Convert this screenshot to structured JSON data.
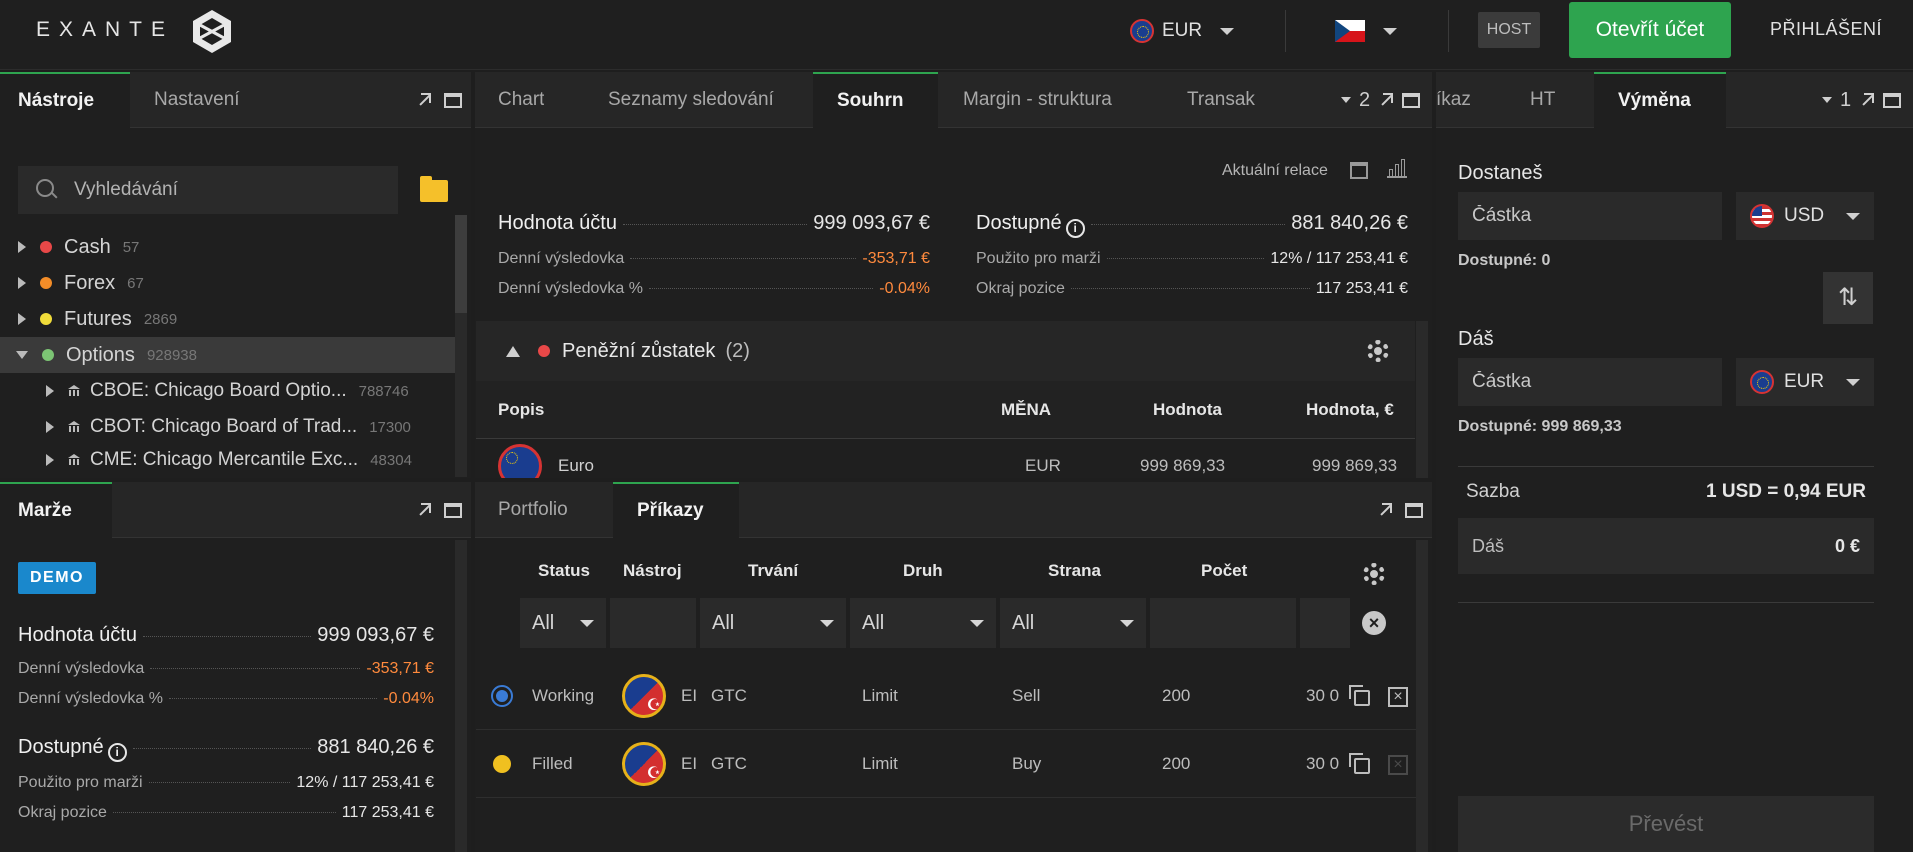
{
  "header": {
    "logo_text": "EXANTE",
    "currency": "EUR",
    "language_flag": "cz-flag",
    "host_label": "HOST",
    "open_account_label": "Otevřít účet",
    "login_label": "PŘIHLÁŠENÍ"
  },
  "left_top": {
    "tabs": [
      "Nástroje",
      "Nastavení"
    ],
    "search_placeholder": "Vyhledávání",
    "tree": [
      {
        "label": "Cash",
        "count": "57",
        "color": "#e84848"
      },
      {
        "label": "Forex",
        "count": "67",
        "color": "#f28c28"
      },
      {
        "label": "Futures",
        "count": "2869",
        "color": "#f0dc3a"
      },
      {
        "label": "Options",
        "count": "928938",
        "color": "#7cc474"
      }
    ],
    "subtree": [
      {
        "label": "CBOE: Chicago Board Optio...",
        "count": "788746"
      },
      {
        "label": "CBOT: Chicago Board of Trad...",
        "count": "17300"
      },
      {
        "label": "CME: Chicago Mercantile Exc...",
        "count": "48304"
      }
    ]
  },
  "left_bottom": {
    "tab": "Marže",
    "badge": "DEMO",
    "account_value_label": "Hodnota účtu",
    "account_value": "999 093,67 €",
    "daily_pl_label": "Denní výsledovka",
    "daily_pl": "-353,71 €",
    "daily_pl_pct_label": "Denní výsledovka %",
    "daily_pl_pct": "-0.04%",
    "available_label": "Dostupné",
    "available": "881 840,26 €",
    "margin_used_label": "Použito pro marži",
    "margin_used": "12% / 117 253,41 €",
    "position_margin_label": "Okraj pozice",
    "position_margin": "117 253,41 €"
  },
  "center_top": {
    "tabs": [
      "Chart",
      "Seznamy sledování",
      "Souhrn",
      "Margin - struktura",
      "Transak"
    ],
    "tab_count": "2",
    "session_label": "Aktuální relace",
    "account_value_label": "Hodnota účtu",
    "account_value": "999 093,67 €",
    "daily_pl_label": "Denní výsledovka",
    "daily_pl": "-353,71 €",
    "daily_pl_pct_label": "Denní výsledovka %",
    "daily_pl_pct": "-0.04%",
    "available_label": "Dostupné",
    "available": "881 840,26 €",
    "margin_used_label": "Použito pro marži",
    "margin_used": "12% / 117 253,41 €",
    "position_margin_label": "Okraj pozice",
    "position_margin": "117 253,41 €",
    "cash_section_label": "Peněžní zůstatek",
    "cash_section_count": "(2)",
    "table_headers": [
      "Popis",
      "MĚNA",
      "Hodnota",
      "Hodnota, €"
    ],
    "rows": [
      {
        "name": "Euro",
        "currency": "EUR",
        "value": "999 869,33",
        "value_eur": "999 869,33"
      }
    ]
  },
  "center_bottom": {
    "tabs": [
      "Portfolio",
      "Příkazy"
    ],
    "headers": [
      "Status",
      "Nástroj",
      "Trvání",
      "Druh",
      "Strana",
      "Počet"
    ],
    "filters": [
      "All",
      "",
      "All",
      "All",
      "All",
      "",
      ""
    ],
    "orders": [
      {
        "status": "Working",
        "instrument": "EI",
        "duration": "GTC",
        "type": "Limit",
        "side": "Sell",
        "qty": "200",
        "price": "30 0",
        "status_color": "#3a7bd5"
      },
      {
        "status": "Filled",
        "instrument": "EI",
        "duration": "GTC",
        "type": "Limit",
        "side": "Buy",
        "qty": "200",
        "price": "30 0",
        "status_color": "#f0c020"
      }
    ]
  },
  "right": {
    "tabs": [
      "íkaz",
      "HT",
      "Výměna"
    ],
    "tab_count": "1",
    "receive_label": "Dostaneš",
    "amount_placeholder": "Částka",
    "receive_currency": "USD",
    "receive_available": "Dostupné: 0",
    "give_label": "Dáš",
    "give_currency": "EUR",
    "give_available": "Dostupné: 999 869,33",
    "rate_label": "Sazba",
    "rate_value": "1 USD = 0,94 EUR",
    "give_summary_label": "Dáš",
    "give_summary_value": "0 €",
    "convert_label": "Převést"
  }
}
